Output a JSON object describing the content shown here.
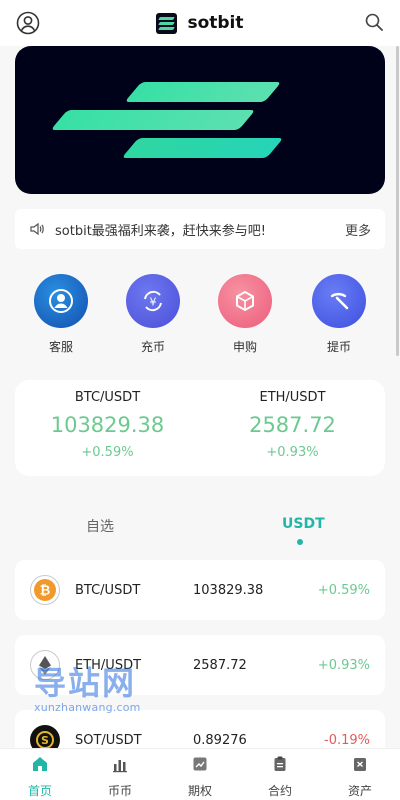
{
  "header": {
    "brand": "sotbit",
    "user_icon": "user-circle-icon",
    "search_icon": "search-icon"
  },
  "notice": {
    "text": "sotbit最强福利来袭，赶快来参与吧!",
    "more": "更多",
    "icon": "speaker-icon"
  },
  "quick_actions": [
    {
      "label": "客服",
      "icon": "customer-service-icon",
      "color": "#1f6fd6"
    },
    {
      "label": "充币",
      "icon": "deposit-icon",
      "color": "#5a63e8"
    },
    {
      "label": "申购",
      "icon": "subscribe-icon",
      "color": "#f2718a"
    },
    {
      "label": "提币",
      "icon": "withdraw-icon",
      "color": "#4a5bea"
    }
  ],
  "ticker": [
    {
      "pair": "BTC/USDT",
      "price": "103829.38",
      "change": "+0.59%"
    },
    {
      "pair": "ETH/USDT",
      "price": "2587.72",
      "change": "+0.93%"
    }
  ],
  "tabs": {
    "favorites": "自选",
    "usdt": "USDT"
  },
  "markets": [
    {
      "pair": "BTC/USDT",
      "price": "103829.38",
      "change": "+0.59%",
      "direction": "up",
      "icon": "btc-icon"
    },
    {
      "pair": "ETH/USDT",
      "price": "2587.72",
      "change": "+0.93%",
      "direction": "up",
      "icon": "eth-icon"
    },
    {
      "pair": "SOT/USDT",
      "price": "0.89276",
      "change": "-0.19%",
      "direction": "down",
      "icon": "sot-icon"
    }
  ],
  "watermark": {
    "cn": "导站网",
    "en": "xunzhanwang.com"
  },
  "tabbar": [
    {
      "label": "首页",
      "icon": "home-icon",
      "active": true
    },
    {
      "label": "币币",
      "icon": "spot-icon",
      "active": false
    },
    {
      "label": "期权",
      "icon": "options-icon",
      "active": false
    },
    {
      "label": "合约",
      "icon": "contract-icon",
      "active": false
    },
    {
      "label": "资产",
      "icon": "assets-icon",
      "active": false
    }
  ],
  "colors": {
    "accent": "#22b6a8",
    "up": "#6cc990",
    "down": "#e55a5a"
  }
}
